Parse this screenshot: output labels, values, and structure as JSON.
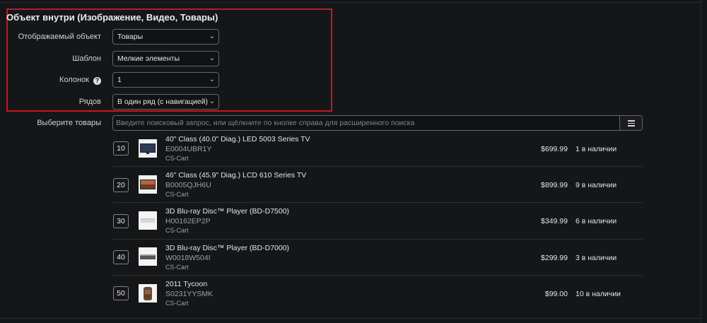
{
  "section": {
    "title": "Объект внутри (Изображение, Видео, Товары)"
  },
  "fields": {
    "display_object": {
      "label": "Отображаемый объект",
      "value": "Товары"
    },
    "template": {
      "label": "Шаблон",
      "value": "Мелкие элементы"
    },
    "columns": {
      "label": "Колонок",
      "help": "?",
      "value": "1"
    },
    "rows": {
      "label": "Рядов",
      "value": "В один ряд (с навигацией)"
    }
  },
  "product_picker": {
    "label": "Выберите товары",
    "placeholder": "Введите поисковый запрос, или щёлкните по кнопке справа для расширенного поиска"
  },
  "products": [
    {
      "position": "10",
      "name": "40\" Class (40.0\" Diag.) LED 5003 Series TV",
      "code": "E0004UBR1Y",
      "vendor": "CS-Cart",
      "price": "$699.99",
      "stock": "1 в наличии",
      "thumb": "tv"
    },
    {
      "position": "20",
      "name": "46\" Class (45.9\" Diag.) LCD 610 Series TV",
      "code": "B0005QJH6U",
      "vendor": "CS-Cart",
      "price": "$899.99",
      "stock": "9 в наличии",
      "thumb": "tv-scenic"
    },
    {
      "position": "30",
      "name": "3D Blu-ray Disc™ Player (BD-D7500)",
      "code": "H00162EP2P",
      "vendor": "CS-Cart",
      "price": "$349.99",
      "stock": "6 в наличии",
      "thumb": "player-flat"
    },
    {
      "position": "40",
      "name": "3D Blu-ray Disc™ Player (BD-D7000)",
      "code": "W0018W504I",
      "vendor": "CS-Cart",
      "price": "$299.99",
      "stock": "3 в наличии",
      "thumb": "player"
    },
    {
      "position": "50",
      "name": "2011 Tycoon",
      "code": "S0231YYSMK",
      "vendor": "CS-Cart",
      "price": "$99.00",
      "stock": "10 в наличии",
      "thumb": "backpack"
    }
  ],
  "colors": {
    "background": "#151618",
    "highlight_border": "#c8171c",
    "field_border": "#61656b"
  }
}
